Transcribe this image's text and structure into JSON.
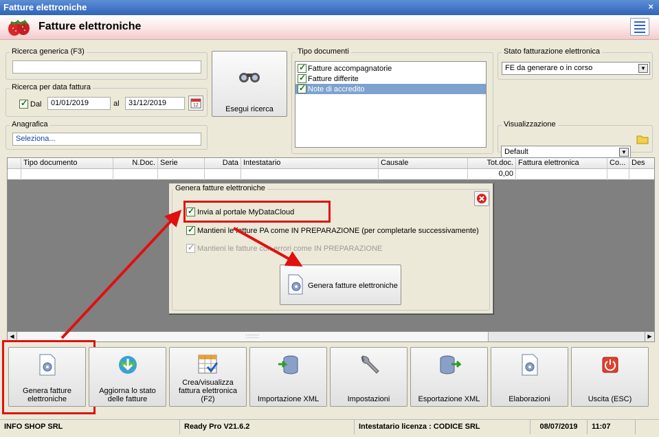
{
  "window": {
    "title": "Fatture elettroniche",
    "close": "×"
  },
  "header": {
    "title": "Fatture elettroniche"
  },
  "search": {
    "generic_label": "Ricerca generica (F3)",
    "generic_value": "",
    "date_label": "Ricerca per data fattura",
    "dal_label": "Dal",
    "date_from": "01/01/2019",
    "al_label": "al",
    "date_to": "31/12/2019",
    "anagrafica_label": "Anagrafica",
    "anagrafica_value": "Seleziona...",
    "search_button": "Esegui ricerca"
  },
  "tipo_documenti": {
    "label": "Tipo documenti",
    "items": [
      {
        "label": "Fatture accompagnatorie",
        "checked": true
      },
      {
        "label": "Fatture differite",
        "checked": true
      },
      {
        "label": "Note di accredito",
        "checked": true
      }
    ]
  },
  "stato": {
    "label": "Stato fatturazione elettronica",
    "value": "FE da generare o in corso"
  },
  "visualizzazione": {
    "label": "Visualizzazione",
    "value": "Default"
  },
  "grid": {
    "columns": [
      "",
      "Tipo documento",
      "N.Doc.",
      "Serie",
      "Data",
      "Intestatario",
      "Causale",
      "Tot.doc.",
      "Fattura elettronica",
      "Co...",
      "Des"
    ],
    "row": [
      "",
      "",
      "",
      "",
      "",
      "",
      "",
      "0,00",
      "",
      "",
      ""
    ],
    "scroll_grip": "::::::::"
  },
  "dialog": {
    "title": "Genera fatture elettroniche",
    "options": [
      {
        "label": "Invia al portale MyDataCloud",
        "checked": true,
        "enabled": true
      },
      {
        "label": "Mantieni le fatture PA come IN PREPARAZIONE (per completarle successivamente)",
        "checked": true,
        "enabled": true
      },
      {
        "label": "Mantieni le fatture con errori come IN PREPARAZIONE",
        "checked": true,
        "enabled": false
      }
    ],
    "button": "Genera fatture elettroniche"
  },
  "toolbar": [
    {
      "label": "Genera fatture elettroniche",
      "icon": "gear-document-icon"
    },
    {
      "label": "Aggiorna lo stato delle fatture",
      "icon": "globe-download-icon"
    },
    {
      "label": "Crea/visualizza fattura elettronica (F2)",
      "icon": "table-check-icon"
    },
    {
      "label": "Importazione XML",
      "icon": "database-import-icon"
    },
    {
      "label": "Impostazioni",
      "icon": "wrench-icon"
    },
    {
      "label": "Esportazione XML",
      "icon": "database-export-icon"
    },
    {
      "label": "Elaborazioni",
      "icon": "gear-document-icon"
    },
    {
      "label": "Uscita (ESC)",
      "icon": "power-icon"
    }
  ],
  "status": {
    "company": "INFO SHOP SRL",
    "version": "Ready Pro V21.6.2",
    "license": "Intestatario licenza : CODICE SRL",
    "date": "08/07/2019",
    "time": "11:07"
  },
  "colors": {
    "highlight_red": "#e01010",
    "title_blue": "#2f63b8",
    "selection": "#7da2ce"
  }
}
